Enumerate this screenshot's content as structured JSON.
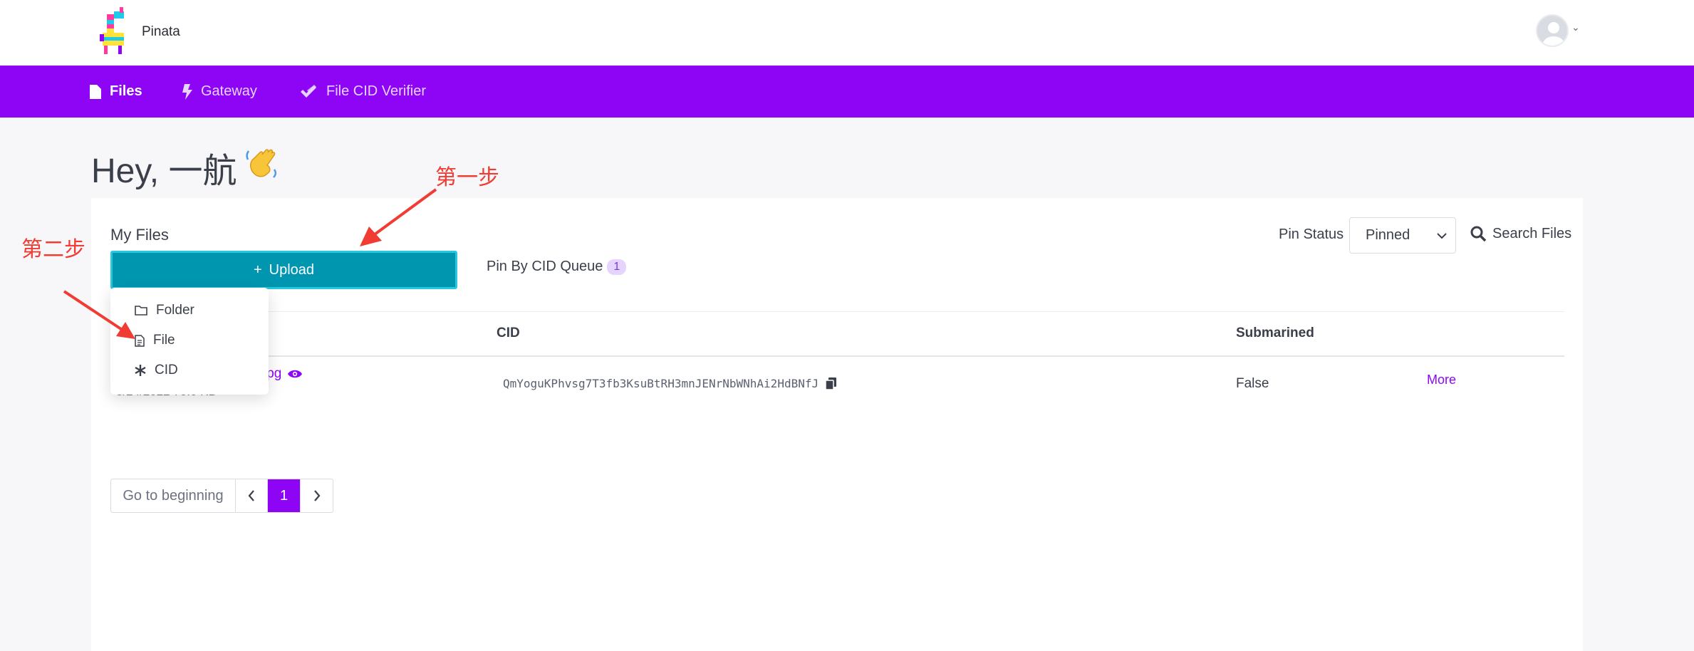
{
  "header": {
    "brand": "Pinata"
  },
  "nav": {
    "items": [
      {
        "label": "Files",
        "icon": "file-icon",
        "active": true
      },
      {
        "label": "Gateway",
        "icon": "bolt-icon",
        "active": false
      },
      {
        "label": "File CID Verifier",
        "icon": "double-check-icon",
        "active": false
      }
    ]
  },
  "main": {
    "greeting": "Hey, 一航",
    "wave_emoji": "👋",
    "section_title": "My Files",
    "upload_label": "Upload",
    "upload_plus": "+",
    "queue_label": "Pin By CID Queue",
    "queue_count": "1",
    "pin_status_label": "Pin Status",
    "pin_status_value": "Pinned",
    "search_label": "Search Files"
  },
  "upload_menu": {
    "items": [
      {
        "label": "Folder",
        "icon": "folder-icon"
      },
      {
        "label": "File",
        "icon": "document-icon"
      },
      {
        "label": "CID",
        "icon": "asterisk-icon"
      }
    ]
  },
  "table": {
    "headers": [
      "CID",
      "Submarined"
    ],
    "rows": [
      {
        "name_visible": "jpg",
        "meta_visible": "5/24/2022 70.0 KB",
        "cid": "QmYoguKPhvsg7T3fb3KsuBtRH3mnJENrNbWNhAi2HdBNfJ",
        "submarined": "False",
        "action": "More"
      }
    ]
  },
  "pagination": {
    "first_label": "Go to beginning",
    "prev": "‹",
    "current": "1",
    "next": "›"
  },
  "annotations": {
    "step1": "第一步",
    "step2": "第二步",
    "color": "#f03c32"
  },
  "colors": {
    "brand_purple": "#8e05f5",
    "upload_teal": "#0096b0"
  }
}
